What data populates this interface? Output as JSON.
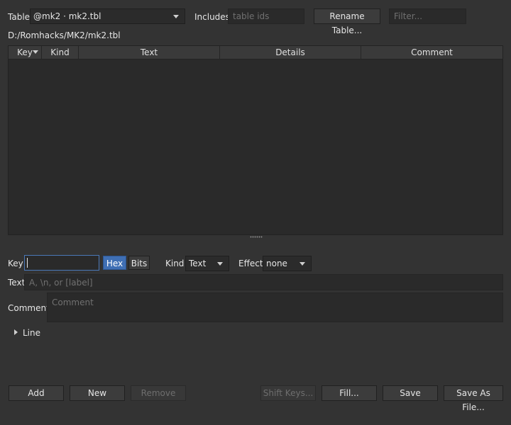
{
  "top": {
    "table_label": "Table",
    "table_value": "@mk2  ·  mk2.tbl",
    "includes_label": "Includes",
    "includes_placeholder": "table ids",
    "rename_button": "Rename Table...",
    "filter_placeholder": "Filter...",
    "path": "D:/Romhacks/MK2/mk2.tbl"
  },
  "table": {
    "columns": [
      "Key",
      "Kind",
      "Text",
      "Details",
      "Comment"
    ],
    "rows": []
  },
  "editor": {
    "key_label": "Key",
    "key_value": "",
    "hex_button": "Hex",
    "bits_button": "Bits",
    "kind_label": "Kind",
    "kind_value": "Text",
    "effect_label": "Effect",
    "effect_value": "none",
    "text_label": "Text",
    "text_placeholder": "A, \\n, or [label]",
    "comment_label": "Comment",
    "comment_placeholder": "Comment",
    "line_section": "Line"
  },
  "bottom": {
    "add": "Add",
    "new": "New",
    "remove": "Remove",
    "shift_keys": "Shift Keys...",
    "fill": "Fill...",
    "save": "Save",
    "save_as_file": "Save As File..."
  },
  "colors": {
    "background": "#333333",
    "accent": "#3f6fb4",
    "field": "#2a2a2a"
  }
}
